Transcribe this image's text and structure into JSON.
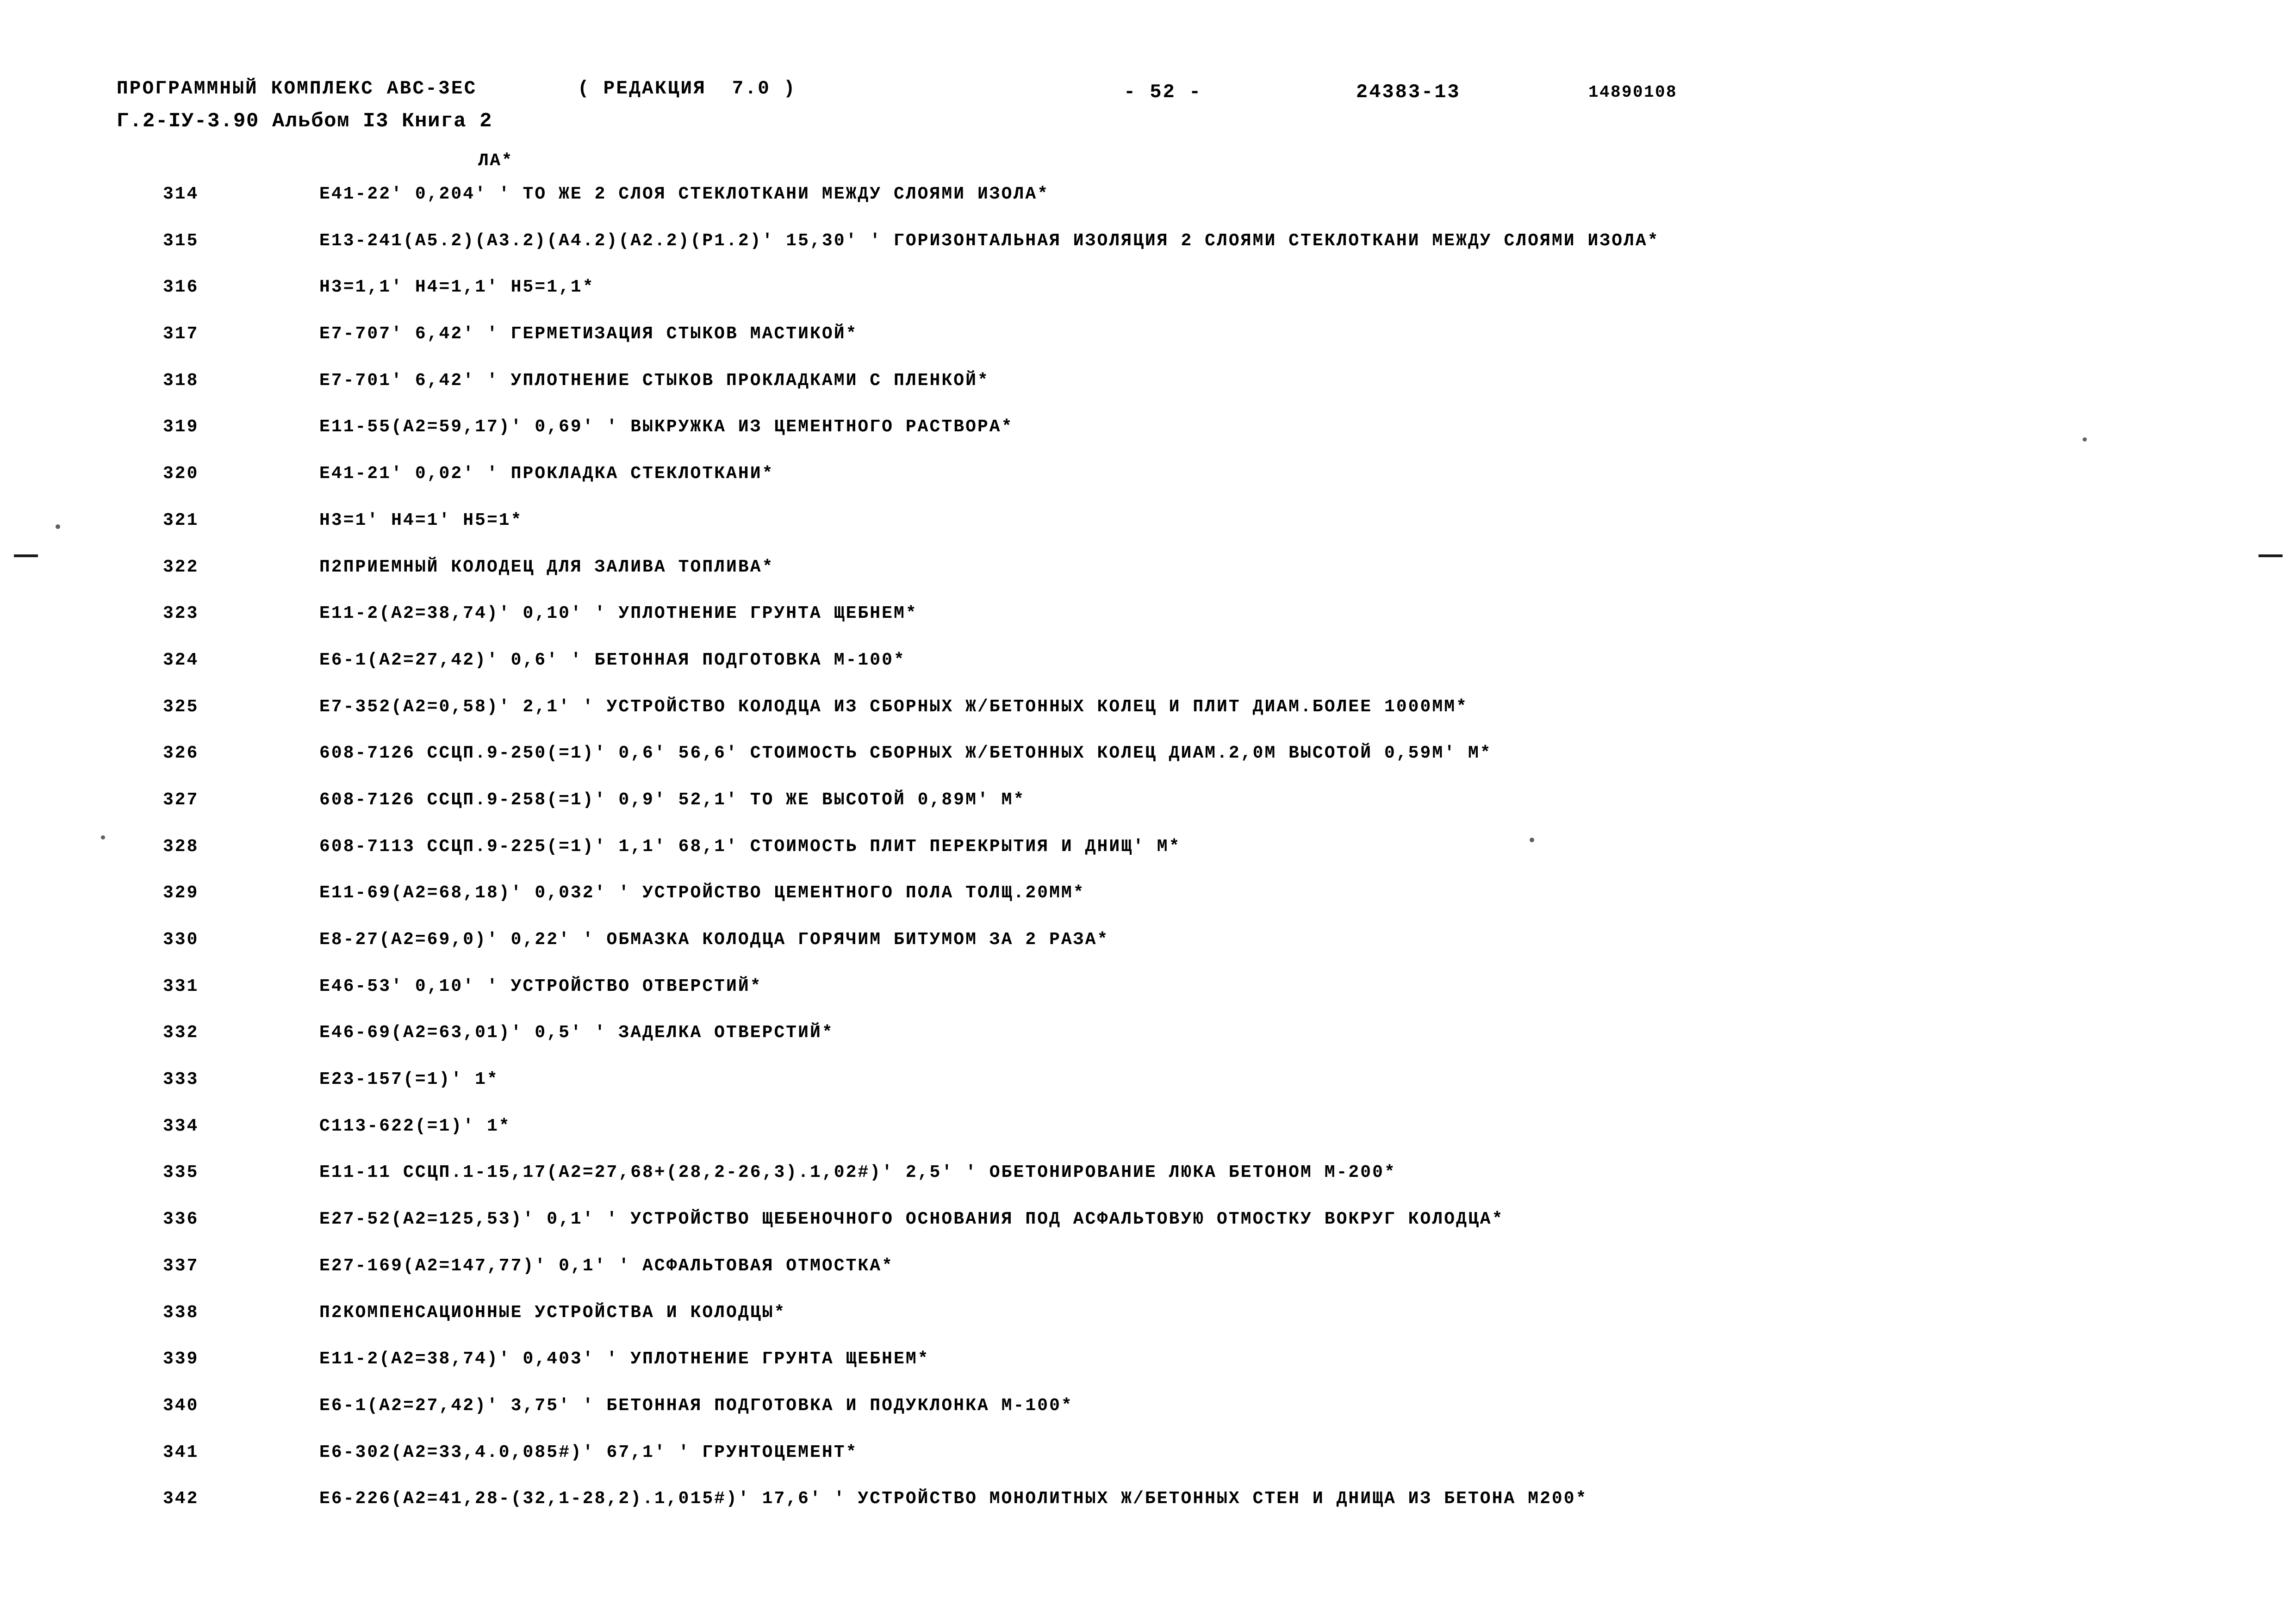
{
  "header": {
    "program": "ПРОГРАММНЫЙ КОМПЛЕКС АВС-3ЕС",
    "revision": "( РЕДАКЦИЯ  7.0 )",
    "album": "Г.2-IУ-3.90 Альбом I3 Книга 2",
    "page_number": "- 52 -",
    "document_number": "24383-13",
    "job_code": "14890108",
    "section_marker": "ЛА*"
  },
  "listing": {
    "rows": [
      {
        "num": "314",
        "text": "Е41-22' 0,204' ' ТО ЖЕ 2 СЛОЯ СТЕКЛОТКАНИ МЕЖДУ СЛОЯМИ ИЗОЛА*"
      },
      {
        "num": "315",
        "text": "Е13-241(А5.2)(А3.2)(А4.2)(А2.2)(Р1.2)' 15,30' ' ГОРИЗОНТАЛЬНАЯ ИЗОЛЯЦИЯ 2 СЛОЯМИ СТЕКЛОТКАНИ МЕЖДУ СЛОЯМИ ИЗОЛА*"
      },
      {
        "num": "316",
        "text": "Н3=1,1' Н4=1,1' Н5=1,1*"
      },
      {
        "num": "317",
        "text": "Е7-707' 6,42' ' ГЕРМЕТИЗАЦИЯ СТЫКОВ МАСТИКОЙ*"
      },
      {
        "num": "318",
        "text": "Е7-701' 6,42' ' УПЛОТНЕНИЕ СТЫКОВ ПРОКЛАДКАМИ С ПЛЕНКОЙ*"
      },
      {
        "num": "319",
        "text": "Е11-55(А2=59,17)' 0,69' ' ВЫКРУЖКА ИЗ ЦЕМЕНТНОГО РАСТВОРА*"
      },
      {
        "num": "320",
        "text": "Е41-21' 0,02' ' ПРОКЛАДКА СТЕКЛОТКАНИ*"
      },
      {
        "num": "321",
        "text": "Н3=1' Н4=1' Н5=1*"
      },
      {
        "num": "322",
        "text": "П2ПРИЕМНЫЙ КОЛОДЕЦ ДЛЯ ЗАЛИВА ТОПЛИВА*"
      },
      {
        "num": "323",
        "text": "Е11-2(А2=38,74)' 0,10' ' УПЛОТНЕНИЕ ГРУНТА ЩЕБНЕМ*"
      },
      {
        "num": "324",
        "text": "Е6-1(А2=27,42)' 0,6' ' БЕТОННАЯ ПОДГОТОВКА М-100*"
      },
      {
        "num": "325",
        "text": "Е7-352(А2=0,58)' 2,1' ' УСТРОЙСТВО КОЛОДЦА ИЗ СБОРНЫХ Ж/БЕТОННЫХ КОЛЕЦ И ПЛИТ ДИАМ.БОЛЕЕ 1000ММ*"
      },
      {
        "num": "326",
        "text": "608-7126 ССЦП.9-250(=1)' 0,6' 56,6' СТОИМОСТЬ СБОРНЫХ Ж/БЕТОННЫХ КОЛЕЦ ДИАМ.2,0М ВЫСОТОЙ 0,59М' М*"
      },
      {
        "num": "327",
        "text": "608-7126 ССЦП.9-258(=1)' 0,9' 52,1' ТО ЖЕ ВЫСОТОЙ 0,89М' М*"
      },
      {
        "num": "328",
        "text": "608-7113 ССЦП.9-225(=1)' 1,1' 68,1' СТОИМОСТЬ ПЛИТ ПЕРЕКРЫТИЯ И ДНИЩ' М*"
      },
      {
        "num": "329",
        "text": "Е11-69(А2=68,18)' 0,032' ' УСТРОЙСТВО ЦЕМЕНТНОГО ПОЛА ТОЛЩ.20ММ*"
      },
      {
        "num": "330",
        "text": "Е8-27(А2=69,0)' 0,22' ' ОБМАЗКА КОЛОДЦА ГОРЯЧИМ БИТУМОМ ЗА 2 РАЗА*"
      },
      {
        "num": "331",
        "text": "Е46-53' 0,10' ' УСТРОЙСТВО ОТВЕРСТИЙ*"
      },
      {
        "num": "332",
        "text": "Е46-69(А2=63,01)' 0,5' ' ЗАДЕЛКА ОТВЕРСТИЙ*"
      },
      {
        "num": "333",
        "text": "Е23-157(=1)' 1*"
      },
      {
        "num": "334",
        "text": "С113-622(=1)' 1*"
      },
      {
        "num": "335",
        "text": "Е11-11 ССЦП.1-15,17(А2=27,68+(28,2-26,3).1,02#)' 2,5' ' ОБЕТОНИРОВАНИЕ ЛЮКА БЕТОНОМ М-200*"
      },
      {
        "num": "336",
        "text": "Е27-52(А2=125,53)' 0,1' ' УСТРОЙСТВО ЩЕБЕНОЧНОГО ОСНОВАНИЯ ПОД АСФАЛЬТОВУЮ ОТМОСТКУ ВОКРУГ КОЛОДЦА*"
      },
      {
        "num": "337",
        "text": "Е27-169(А2=147,77)' 0,1' ' АСФАЛЬТОВАЯ ОТМОСТКА*"
      },
      {
        "num": "338",
        "text": "П2КОМПЕНСАЦИОННЫЕ УСТРОЙСТВА И КОЛОДЦЫ*"
      },
      {
        "num": "339",
        "text": "Е11-2(А2=38,74)' 0,403' ' УПЛОТНЕНИЕ ГРУНТА ЩЕБНЕМ*"
      },
      {
        "num": "340",
        "text": "Е6-1(А2=27,42)' 3,75' ' БЕТОННАЯ ПОДГОТОВКА И ПОДУКЛОНКА М-100*"
      },
      {
        "num": "341",
        "text": "Е6-302(А2=33,4.0,085#)' 67,1' ' ГРУНТОЦЕМЕНТ*"
      },
      {
        "num": "342",
        "text": "Е6-226(А2=41,28-(32,1-28,2).1,015#)' 17,6' ' УСТРОЙСТВО МОНОЛИТНЫХ Ж/БЕТОННЫХ СТЕН И ДНИЩА ИЗ БЕТОНА М200*"
      }
    ]
  }
}
